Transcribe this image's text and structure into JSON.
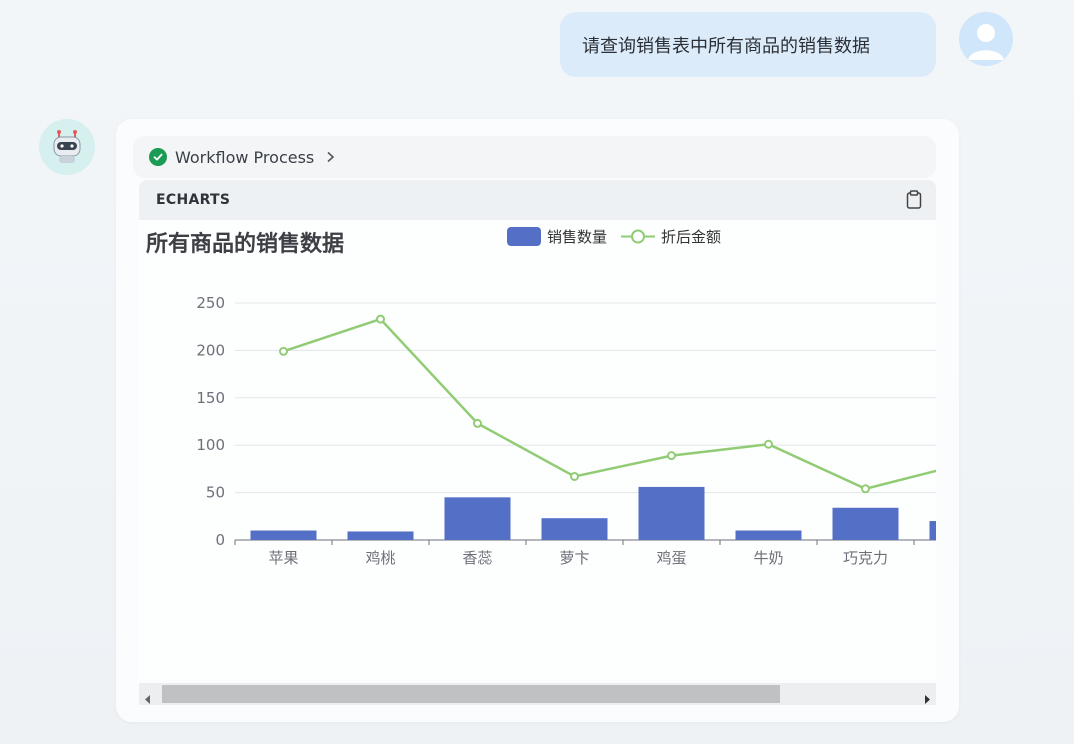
{
  "user_message": {
    "text": "请查询销售表中所有商品的销售数据"
  },
  "workflow": {
    "label": "Workflow Process"
  },
  "code_block": {
    "language": "ECHARTS"
  },
  "colors": {
    "bar": "#5470c6",
    "line": "#91cc75",
    "user_bubble": "#dcebfa",
    "status_ok": "#1a9b56"
  },
  "icons": [
    "user-avatar-icon",
    "robot-avatar-icon",
    "check-circle-icon",
    "chevron-right-icon",
    "clipboard-icon",
    "scroll-left-icon",
    "scroll-right-icon"
  ],
  "chart_data": {
    "type": "bar",
    "title": "所有商品的销售数据",
    "legend_position": "top-center",
    "categories": [
      "苹果",
      "鸡桃",
      "香蕊",
      "萝卞",
      "鸡蛋",
      "牛奶",
      "巧克力",
      ""
    ],
    "series": [
      {
        "name": "销售数量",
        "type": "bar",
        "values": [
          10,
          9,
          45,
          23,
          56,
          10,
          34,
          20
        ]
      },
      {
        "name": "折后金额",
        "type": "line",
        "values": [
          199,
          233,
          123,
          67,
          89,
          101,
          54,
          80
        ]
      }
    ],
    "ylim": [
      0,
      250
    ],
    "yticks": [
      "250",
      "200",
      "150",
      "100",
      "50",
      "0"
    ],
    "grid": true
  }
}
